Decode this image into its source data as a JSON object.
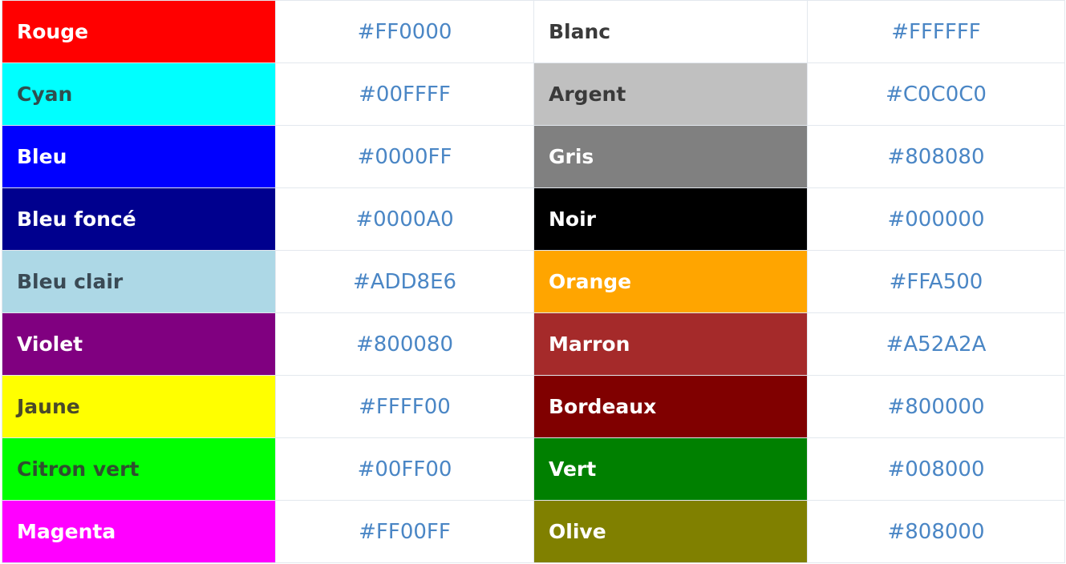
{
  "rows": [
    {
      "left": {
        "name": "Rouge",
        "hex": "#FF0000",
        "bg": "#FF0000",
        "fg": "#FFFFFF"
      },
      "right": {
        "name": "Blanc",
        "hex": "#FFFFFF",
        "bg": "#FFFFFF",
        "fg": "#3a3a3a"
      }
    },
    {
      "left": {
        "name": "Cyan",
        "hex": "#00FFFF",
        "bg": "#00FFFF",
        "fg": "#2f4f4f"
      },
      "right": {
        "name": "Argent",
        "hex": "#C0C0C0",
        "bg": "#C0C0C0",
        "fg": "#3a3a3a"
      }
    },
    {
      "left": {
        "name": "Bleu",
        "hex": "#0000FF",
        "bg": "#0000FF",
        "fg": "#FFFFFF"
      },
      "right": {
        "name": "Gris",
        "hex": "#808080",
        "bg": "#808080",
        "fg": "#FFFFFF"
      }
    },
    {
      "left": {
        "name": "Bleu foncé",
        "hex": "#0000A0",
        "bg": "#00008E",
        "fg": "#FFFFFF"
      },
      "right": {
        "name": "Noir",
        "hex": "#000000",
        "bg": "#000000",
        "fg": "#FFFFFF"
      }
    },
    {
      "left": {
        "name": "Bleu clair",
        "hex": "#ADD8E6",
        "bg": "#ADD8E6",
        "fg": "#3a4a55"
      },
      "right": {
        "name": "Orange",
        "hex": "#FFA500",
        "bg": "#FFA500",
        "fg": "#FFFFFF"
      }
    },
    {
      "left": {
        "name": "Violet",
        "hex": "#800080",
        "bg": "#800080",
        "fg": "#FFFFFF"
      },
      "right": {
        "name": "Marron",
        "hex": "#A52A2A",
        "bg": "#A52A2A",
        "fg": "#FFFFFF"
      }
    },
    {
      "left": {
        "name": "Jaune",
        "hex": "#FFFF00",
        "bg": "#FFFF00",
        "fg": "#4a4a2a"
      },
      "right": {
        "name": "Bordeaux",
        "hex": "#800000",
        "bg": "#800000",
        "fg": "#FFFFFF"
      }
    },
    {
      "left": {
        "name": "Citron vert",
        "hex": "#00FF00",
        "bg": "#00FF00",
        "fg": "#2f4f2f"
      },
      "right": {
        "name": "Vert",
        "hex": "#008000",
        "bg": "#008000",
        "fg": "#FFFFFF"
      }
    },
    {
      "left": {
        "name": "Magenta",
        "hex": "#FF00FF",
        "bg": "#FF00FF",
        "fg": "#FFFFFF"
      },
      "right": {
        "name": "Olive",
        "hex": "#808000",
        "bg": "#808000",
        "fg": "#FFFFFF"
      }
    }
  ]
}
